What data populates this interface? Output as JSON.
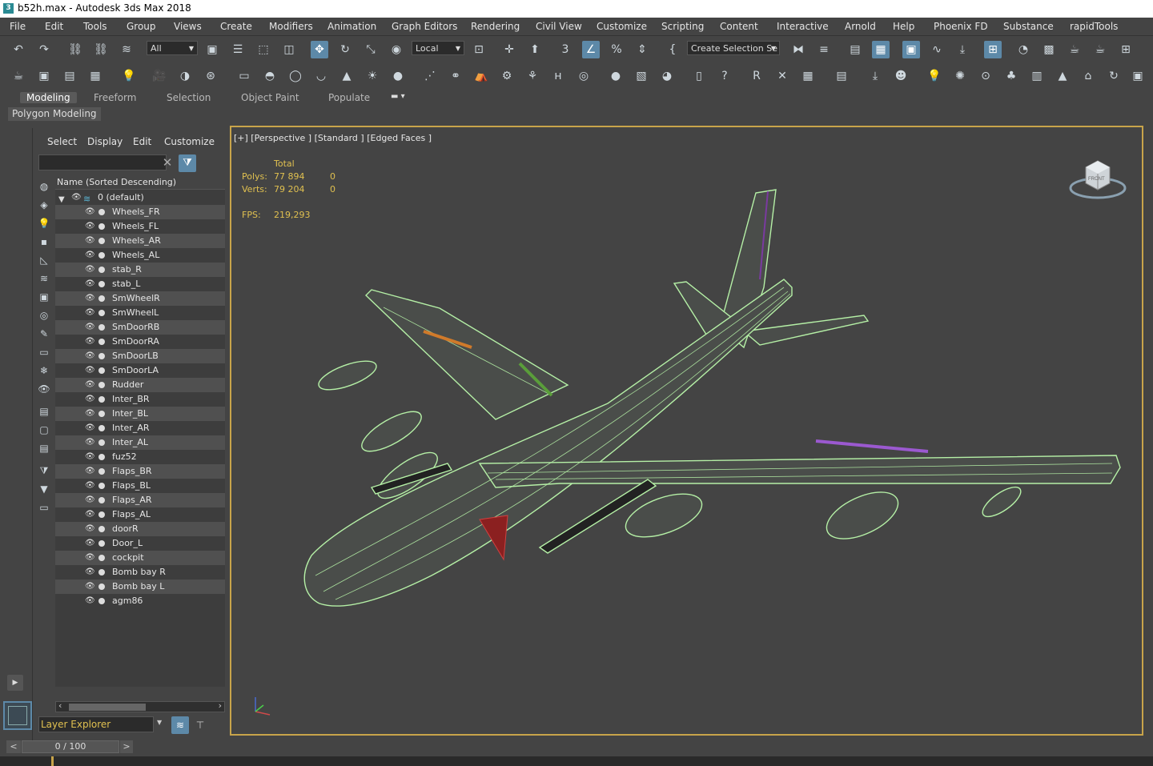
{
  "window": {
    "title": "b52h.max - Autodesk 3ds Max 2018",
    "icon": "3"
  },
  "menu": [
    "File",
    "Edit",
    "Tools",
    "Group",
    "Views",
    "Create",
    "Modifiers",
    "Animation",
    "Graph Editors",
    "Rendering",
    "Civil View",
    "Customize",
    "Scripting",
    "Content",
    "Interactive",
    "Arnold",
    "Help",
    "Phoenix FD",
    "Substance",
    "rapidTools"
  ],
  "toolbar": {
    "filter_dropdown": "All",
    "coord_dropdown": "Local",
    "selection_set": "Create Selection Se"
  },
  "ribbon": {
    "tabs": [
      "Modeling",
      "Freeform",
      "Selection",
      "Object Paint",
      "Populate"
    ],
    "active_tab": "Modeling",
    "panel": "Polygon Modeling"
  },
  "explorer": {
    "menu": [
      "Select",
      "Display",
      "Edit",
      "Customize"
    ],
    "column_header": "Name (Sorted Descending)",
    "root": "0 (default)",
    "objects": [
      "Wheels_FR",
      "Wheels_FL",
      "Wheels_AR",
      "Wheels_AL",
      "stab_R",
      "stab_L",
      "SmWheelR",
      "SmWheelL",
      "SmDoorRB",
      "SmDoorRA",
      "SmDoorLB",
      "SmDoorLA",
      "Rudder",
      "Inter_BR",
      "Inter_BL",
      "Inter_AR",
      "Inter_AL",
      "fuz52",
      "Flaps_BR",
      "Flaps_BL",
      "Flaps_AR",
      "Flaps_AL",
      "doorR",
      "Door_L",
      "cockpit",
      "Bomb bay R",
      "Bomb bay L",
      "agm86"
    ],
    "footer": "Layer Explorer"
  },
  "viewport": {
    "label": "[+] [Perspective ] [Standard ] [Edged Faces ]",
    "stats": {
      "total_label": "Total",
      "polys_label": "Polys:",
      "polys_total": "77 894",
      "polys_sel": "0",
      "verts_label": "Verts:",
      "verts_total": "79 204",
      "verts_sel": "0",
      "fps_label": "FPS:",
      "fps_value": "219,293"
    },
    "viewcube_label": "FRONT",
    "wire_color": "#b5f0a6",
    "border_color": "#c8a44a"
  },
  "timeline": {
    "position": "0 / 100",
    "prev": "<",
    "next": ">"
  }
}
